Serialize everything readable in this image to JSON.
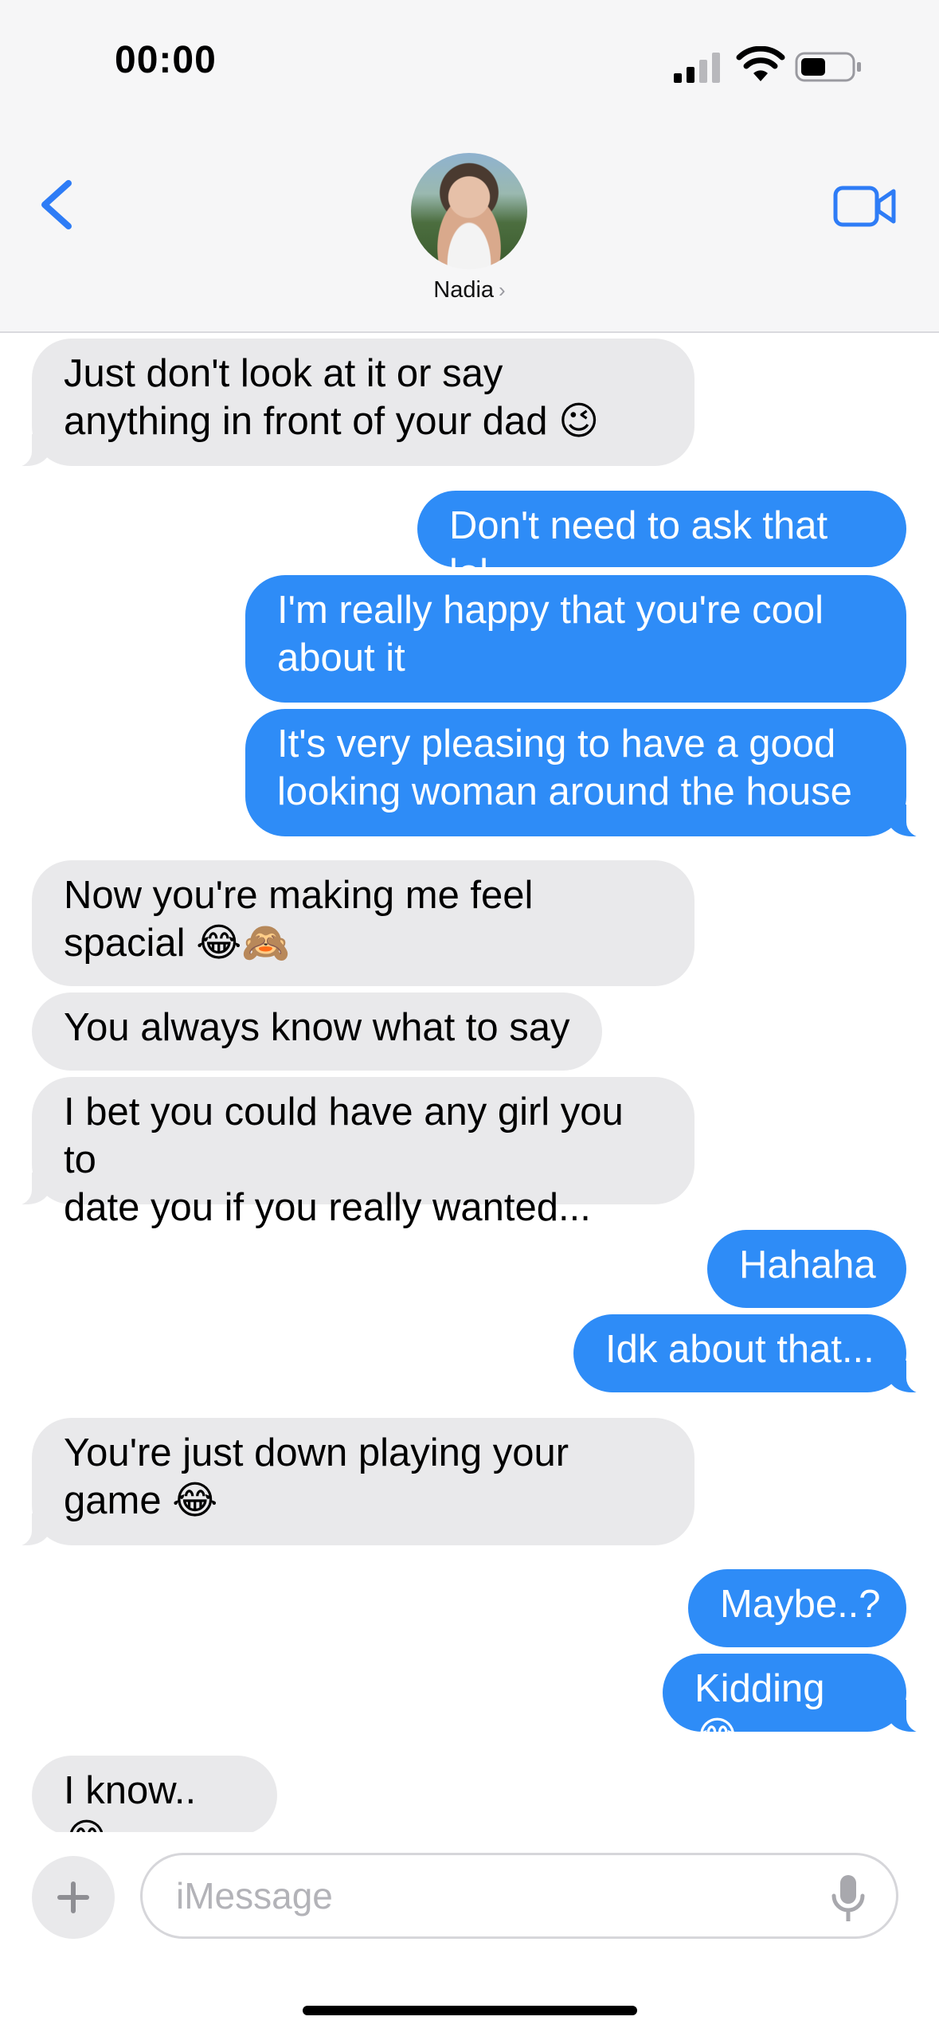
{
  "status_bar": {
    "time": "00:00",
    "icons": [
      "cellular-signal-icon",
      "wifi-icon",
      "battery-icon"
    ]
  },
  "header": {
    "back_icon": "chevron-left-icon",
    "contact_name": "Nadia",
    "contact_chevron": "›",
    "video_icon": "video-camera-icon"
  },
  "messages": [
    {
      "from": "contact",
      "text": "Just don't look at it or say\nanything in front of your dad 😉"
    },
    {
      "from": "me",
      "text": "Don't need to ask that lol"
    },
    {
      "from": "me",
      "text": "I'm really happy that you're cool\nabout it"
    },
    {
      "from": "me",
      "text": "It's very pleasing to have a good\nlooking woman around the house"
    },
    {
      "from": "contact",
      "text": "Now you're making me feel\nspacial 😂🙈"
    },
    {
      "from": "contact",
      "text": "You always know what to say"
    },
    {
      "from": "contact",
      "text": "I bet you could have any girl you to\ndate you if you really wanted..."
    },
    {
      "from": "me",
      "text": "Hahaha"
    },
    {
      "from": "me",
      "text": "Idk about that..."
    },
    {
      "from": "contact",
      "text": "You're just down playing your\ngame 😂"
    },
    {
      "from": "me",
      "text": "Maybe..?"
    },
    {
      "from": "me",
      "text": "Kidding 😂"
    },
    {
      "from": "contact",
      "text": "I know.. 😂"
    }
  ],
  "composer": {
    "placeholder": "iMessage",
    "plus_icon": "plus-icon",
    "mic_icon": "microphone-icon"
  },
  "colors": {
    "outgoing_bubble": "#2e8cf7",
    "incoming_bubble": "#e9e9eb",
    "accent": "#2e7cf6"
  }
}
